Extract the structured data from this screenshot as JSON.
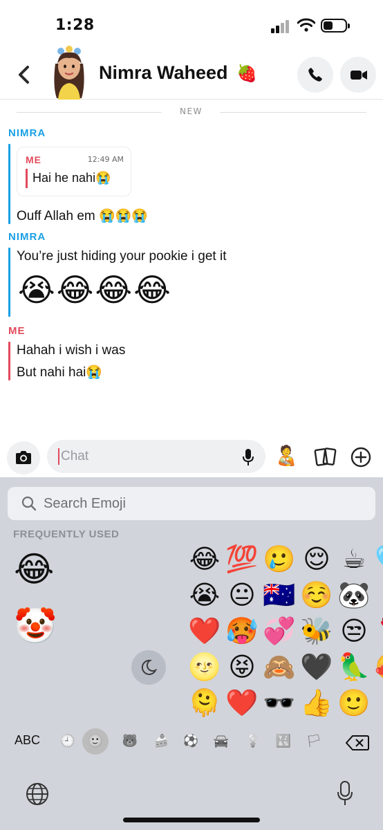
{
  "status_bar": {
    "time": "1:28"
  },
  "header": {
    "contact_name": "Nimra Waheed",
    "name_emoji": "🍓"
  },
  "chat": {
    "divider_label": "NEW",
    "messages": [
      {
        "sender": "NIMRA",
        "quote": {
          "sender": "ME",
          "time": "12:49 AM",
          "text": "Hai he nahi😭"
        },
        "lines": [
          "Ouff Allah em 😭😭😭"
        ]
      },
      {
        "sender": "NIMRA",
        "lines": [
          "You’re just hiding your pookie i get it"
        ],
        "emoji_line": "😭😂😂😂"
      },
      {
        "sender": "ME",
        "lines": [
          "Hahah i wish i was",
          "But nahi hai😭"
        ]
      }
    ]
  },
  "input_bar": {
    "placeholder": "Chat",
    "sticker_emoji": "🧑‍🍼"
  },
  "keyboard": {
    "search_placeholder": "Search Emoji",
    "section_label": "FREQUENTLY USED",
    "large_emojis": [
      "😂",
      "🤡"
    ],
    "emoji_grid": [
      [
        "😂",
        "💯",
        "🥲",
        "😌",
        "☕",
        "🩵"
      ],
      [
        "😭",
        "😐",
        "🇦🇺",
        "☺️",
        "🐼",
        ""
      ],
      [
        "❤️",
        "🥵",
        "💞",
        "🐝",
        "😒",
        "🌹"
      ],
      [
        "🌝",
        "😝",
        "🙈",
        "🖤",
        "🦜",
        "🥰"
      ],
      [
        "🫠",
        "❤️",
        "🕶️",
        "👍",
        "🙂",
        ""
      ]
    ],
    "abc_label": "ABC",
    "categories": [
      {
        "icon": "clock-icon",
        "glyph": "🕘"
      },
      {
        "icon": "smiley-icon",
        "glyph": "🙂",
        "active": true
      },
      {
        "icon": "bear-icon",
        "glyph": "🐻"
      },
      {
        "icon": "food-icon",
        "glyph": "🍰"
      },
      {
        "icon": "ball-icon",
        "glyph": "⚽"
      },
      {
        "icon": "car-icon",
        "glyph": "🚘"
      },
      {
        "icon": "bulb-icon",
        "glyph": "💡"
      },
      {
        "icon": "symbols-icon",
        "glyph": "🔣"
      },
      {
        "icon": "flag-icon",
        "glyph": "🏳"
      }
    ]
  }
}
